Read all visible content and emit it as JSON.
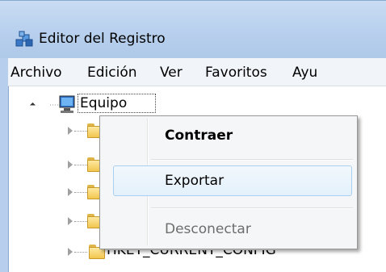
{
  "window": {
    "title": "Editor del Registro",
    "icon": "registry-editor-icon"
  },
  "menubar": {
    "items": [
      "Archivo",
      "Edición",
      "Ver",
      "Favoritos",
      "Ayu"
    ]
  },
  "tree": {
    "root_label": "Equipo",
    "root_icon": "computer-icon",
    "child_icon": "folder-icon",
    "partially_visible_label": "HKEY_CURRENT_CONFIG"
  },
  "context_menu": {
    "items": [
      {
        "label": "Contraer",
        "state": "default-bold"
      },
      {
        "label": "Exportar",
        "state": "hovered"
      },
      {
        "label": "Desconectar",
        "state": "disabled"
      }
    ]
  },
  "colors": {
    "disabled_text": "#6d6d6d",
    "hover_border": "#a8d0f0"
  }
}
